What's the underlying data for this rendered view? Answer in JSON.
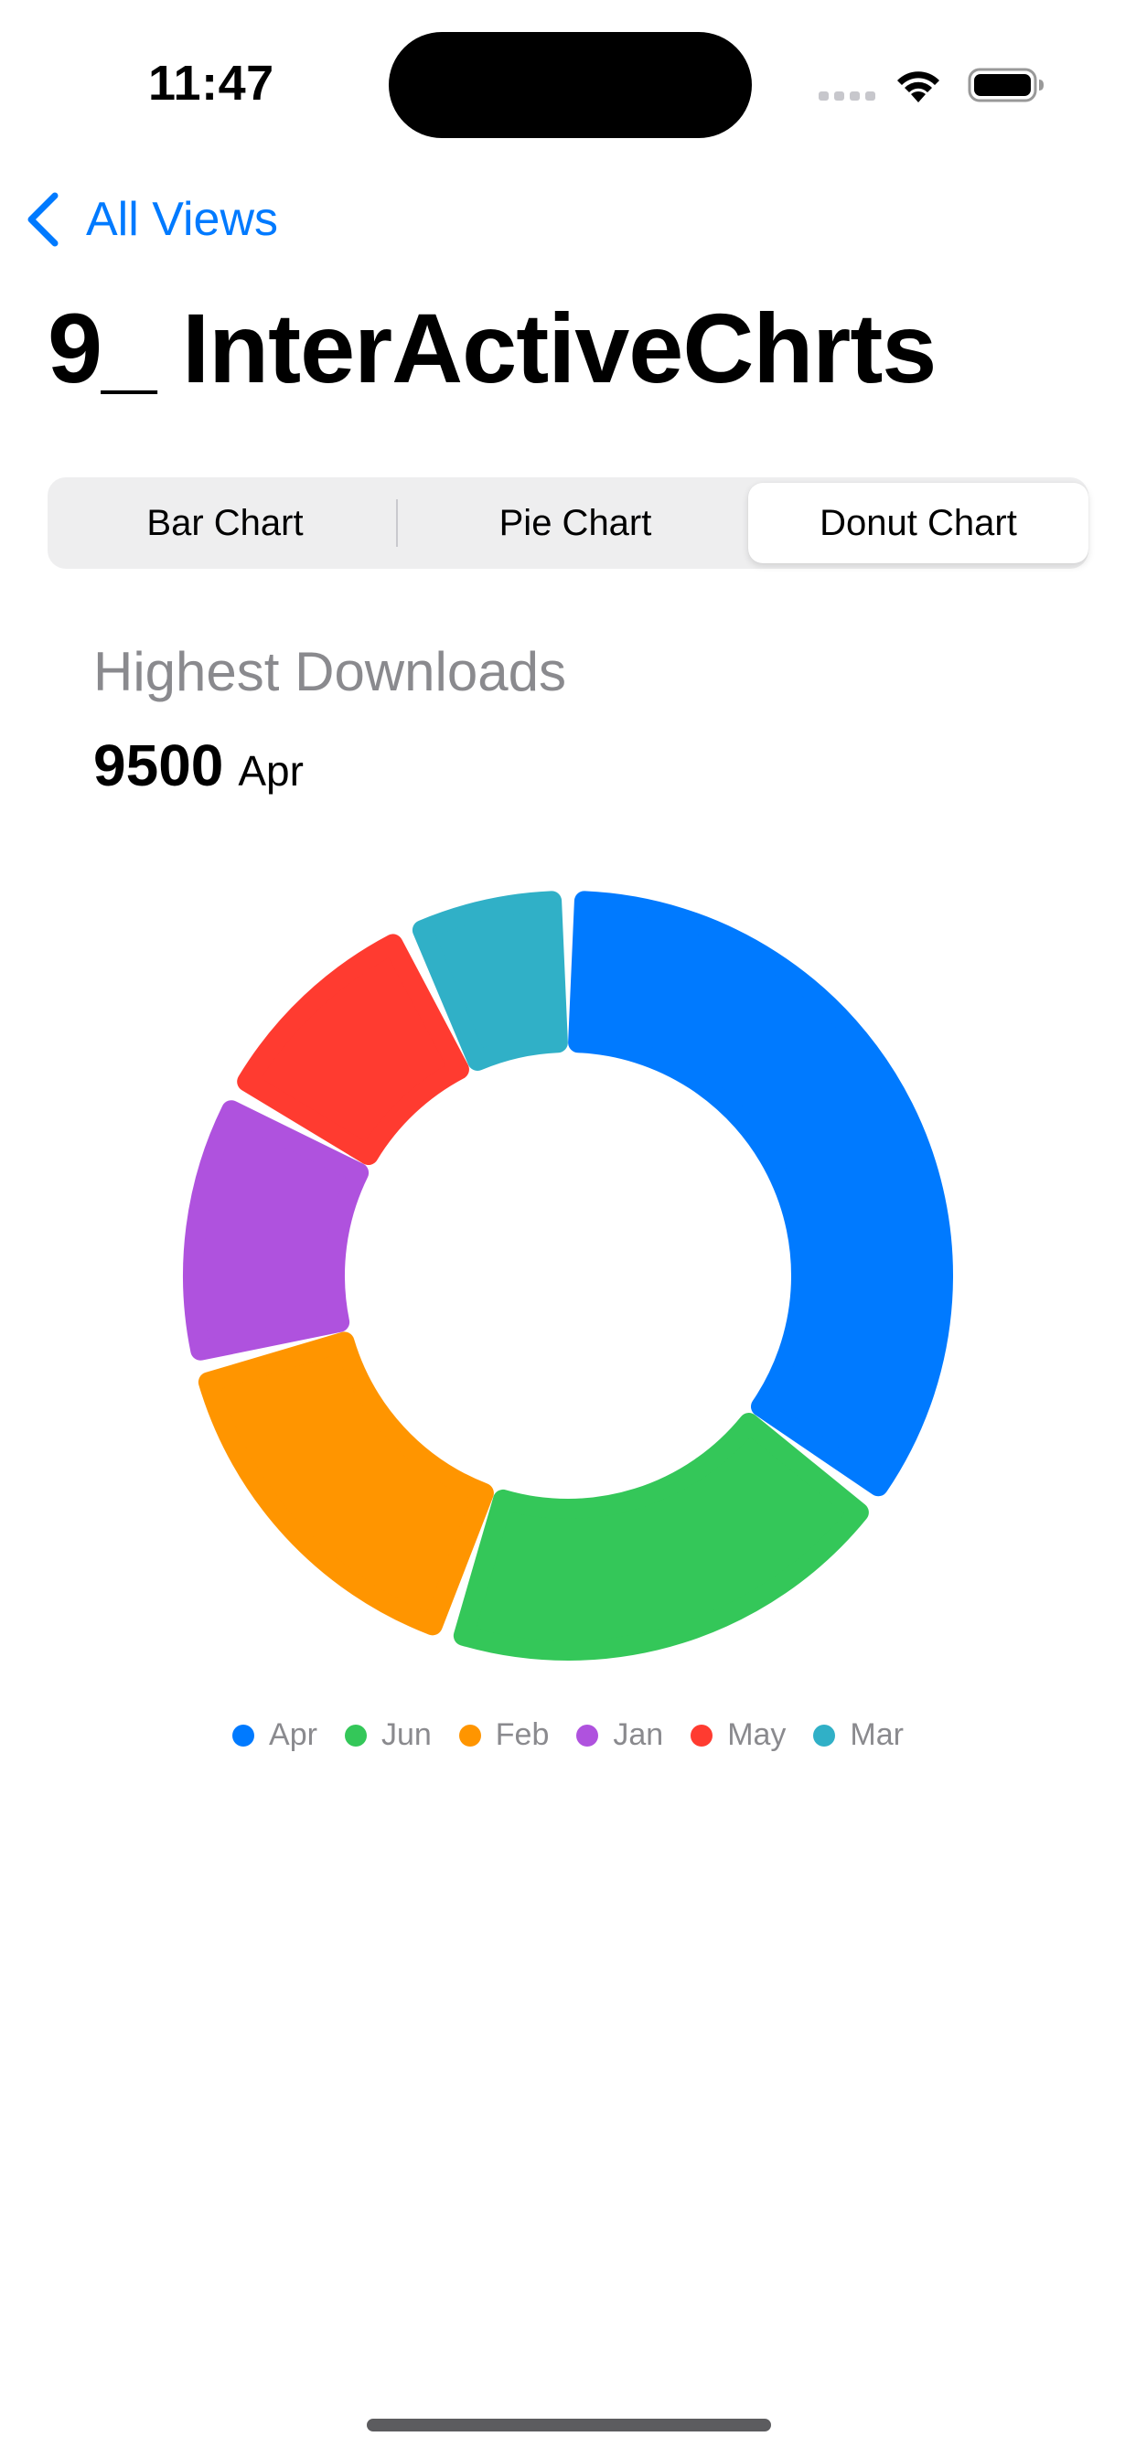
{
  "status_bar": {
    "time": "11:47"
  },
  "nav": {
    "back_label": "All Views",
    "title": "9_ InterActiveChrts"
  },
  "segments": [
    {
      "label": "Bar Chart",
      "selected": false
    },
    {
      "label": "Pie Chart",
      "selected": false
    },
    {
      "label": "Donut Chart",
      "selected": true
    }
  ],
  "highlight": {
    "label": "Highest Downloads",
    "value": "9500",
    "month": "Apr"
  },
  "chart_data": {
    "type": "pie",
    "variant": "donut",
    "categories": [
      "Apr",
      "Jun",
      "Feb",
      "Jan",
      "May",
      "Mar"
    ],
    "values": [
      9500,
      5400,
      4300,
      3200,
      2700,
      1900
    ],
    "colors": [
      "#007AFF",
      "#34C759",
      "#FF9500",
      "#AF52DE",
      "#FF3B30",
      "#30B0C7"
    ],
    "legend": "bottom"
  }
}
